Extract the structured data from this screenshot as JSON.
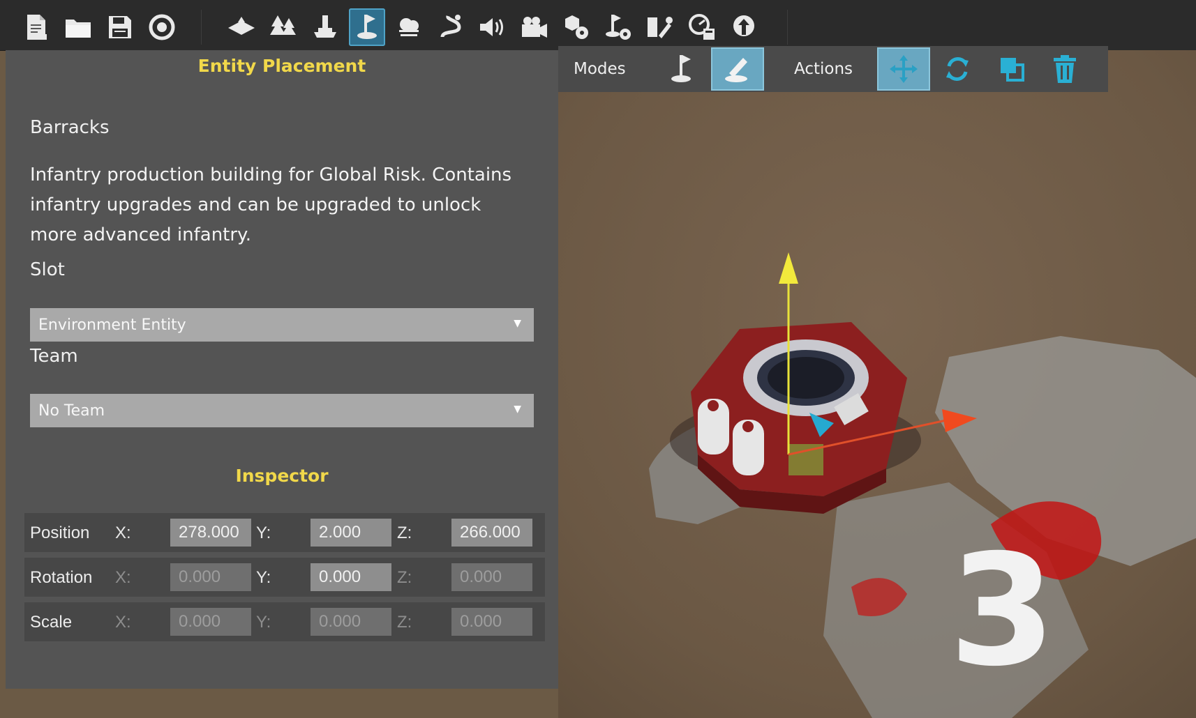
{
  "panel": {
    "title": "Entity Placement",
    "entity_name": "Barracks",
    "description": "Infantry production building for Global Risk. Contains infantry upgrades and can be upgraded to unlock more advanced infantry.",
    "slot_label": "Slot",
    "slot_value": "Environment Entity",
    "team_label": "Team",
    "team_value": "No Team",
    "inspector_title": "Inspector",
    "inspector": {
      "position": {
        "label": "Position",
        "x_label": "X:",
        "x": "278.000",
        "y_label": "Y:",
        "y": "2.000",
        "z_label": "Z:",
        "z": "266.000"
      },
      "rotation": {
        "label": "Rotation",
        "x_label": "X:",
        "x": "0.000",
        "y_label": "Y:",
        "y": "0.000",
        "z_label": "Z:",
        "z": "0.000"
      },
      "scale": {
        "label": "Scale",
        "x_label": "X:",
        "x": "0.000",
        "y_label": "Y:",
        "y": "0.000",
        "z_label": "Z:",
        "z": "0.000"
      }
    }
  },
  "modes_bar": {
    "modes_label": "Modes",
    "actions_label": "Actions"
  },
  "toolbar": {
    "icons": [
      "new-file-icon",
      "open-folder-icon",
      "save-icon",
      "refresh-icon",
      "terrain-icon",
      "trees-icon",
      "stamp-icon",
      "entity-placement-icon",
      "weather-icon",
      "path-icon",
      "sound-icon",
      "camera-icon",
      "settings-cubes-icon",
      "entity-settings-icon",
      "tools-icon",
      "performance-icon",
      "upload-icon"
    ],
    "active_index": 7
  },
  "viewport": {
    "tile_number": "3"
  },
  "colors": {
    "accent": "#f1d84a",
    "active_blue": "#2f6f8e",
    "panel": "#545454",
    "field": "#8e8e8e"
  }
}
